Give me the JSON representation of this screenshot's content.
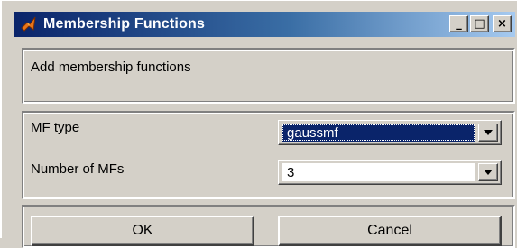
{
  "window": {
    "title": "Membership Functions",
    "minimize_glyph": "_",
    "maximize_glyph": "□",
    "close_glyph": "×"
  },
  "header": {
    "label": "Add membership functions"
  },
  "form": {
    "mf_type_label": "MF type",
    "mf_type_value": "gaussmf",
    "num_mfs_label": "Number of MFs",
    "num_mfs_value": "3"
  },
  "buttons": {
    "ok_label": "OK",
    "cancel_label": "Cancel"
  },
  "colors": {
    "titlebar_start": "#0a246a",
    "titlebar_end": "#a6caf0",
    "selection": "#0a246a",
    "face": "#d4d0c8"
  },
  "icons": {
    "app": "matlab-icon",
    "dropdown": "chevron-down-icon"
  }
}
